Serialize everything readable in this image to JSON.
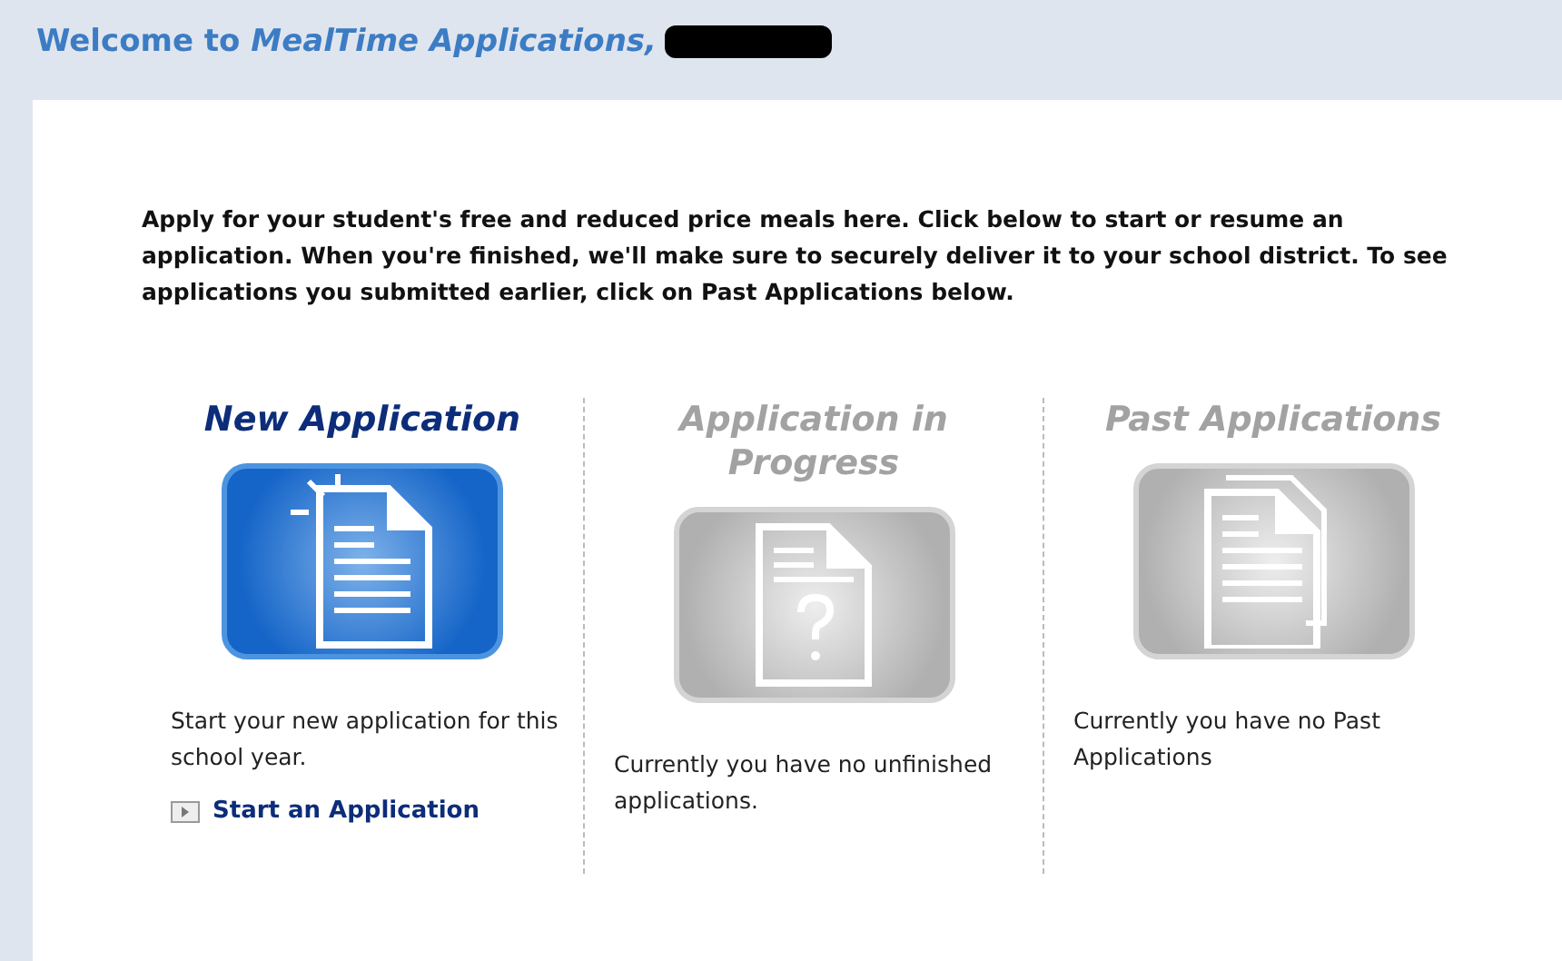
{
  "header": {
    "title": "Welcome to *MealTime Applications,*"
  },
  "intro": "Apply for your student's free and reduced price meals here. Click below to start or resume an application. When you're finished, we'll make sure to securely deliver it to your school district. To see applications you submitted earlier, click on Past Applications below.",
  "options": [
    {
      "kind": "new",
      "title": "New Application",
      "enabled": true,
      "description": "Start your new application for this school year.",
      "link": "Start an Application"
    },
    {
      "kind": "progress",
      "title": "Application in Progress",
      "enabled": false,
      "description": "Currently you have no unfinished applications."
    },
    {
      "kind": "past",
      "title": "Past Applications",
      "enabled": false,
      "description": "Currently you have no Past Applications"
    }
  ]
}
